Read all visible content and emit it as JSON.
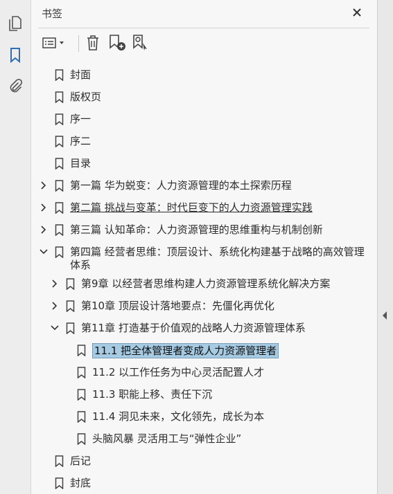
{
  "panel": {
    "title": "书签"
  },
  "rail": {
    "icons": [
      "pages-icon",
      "bookmarks-icon",
      "attachments-icon"
    ]
  },
  "bookmarks": [
    {
      "label": "封面",
      "level": 0,
      "expander": "none"
    },
    {
      "label": "版权页",
      "level": 0,
      "expander": "none"
    },
    {
      "label": "序一",
      "level": 0,
      "expander": "none"
    },
    {
      "label": "序二",
      "level": 0,
      "expander": "none"
    },
    {
      "label": "目录",
      "level": 0,
      "expander": "none"
    },
    {
      "label": "第一篇 华为蜕变：人力资源管理的本土探索历程",
      "level": 0,
      "expander": "collapsed"
    },
    {
      "label": "第二篇 挑战与变革：时代巨变下的人力资源管理实践",
      "level": 0,
      "expander": "collapsed",
      "underlined": true
    },
    {
      "label": "第三篇 认知革命：人力资源管理的思维重构与机制创新",
      "level": 0,
      "expander": "collapsed"
    },
    {
      "label": "第四篇 经营者思维：顶层设计、系统化构建基于战略的高效管理体系",
      "level": 0,
      "expander": "expanded",
      "wrap": true
    },
    {
      "label": "第9章 以经营者思维构建人力资源管理系统化解决方案",
      "level": 1,
      "expander": "collapsed"
    },
    {
      "label": "第10章 顶层设计落地要点：先僵化再优化",
      "level": 1,
      "expander": "collapsed"
    },
    {
      "label": "第11章 打造基于价值观的战略人力资源管理体系",
      "level": 1,
      "expander": "expanded"
    },
    {
      "label": "11.1 把全体管理者变成人力资源管理者",
      "level": 2,
      "expander": "none",
      "selected": true
    },
    {
      "label": "11.2 以工作任务为中心灵活配置人才",
      "level": 2,
      "expander": "none"
    },
    {
      "label": "11.3 职能上移、责任下沉",
      "level": 2,
      "expander": "none"
    },
    {
      "label": "11.4 洞见未来，文化领先，成长为本",
      "level": 2,
      "expander": "none"
    },
    {
      "label": "头脑风暴 灵活用工与“弹性企业”",
      "level": 2,
      "expander": "none"
    },
    {
      "label": "后记",
      "level": 0,
      "expander": "none"
    },
    {
      "label": "封底",
      "level": 0,
      "expander": "none"
    }
  ],
  "colors": {
    "selected_bg": "#a6cbe3",
    "active_icon": "#2a6ebb"
  }
}
